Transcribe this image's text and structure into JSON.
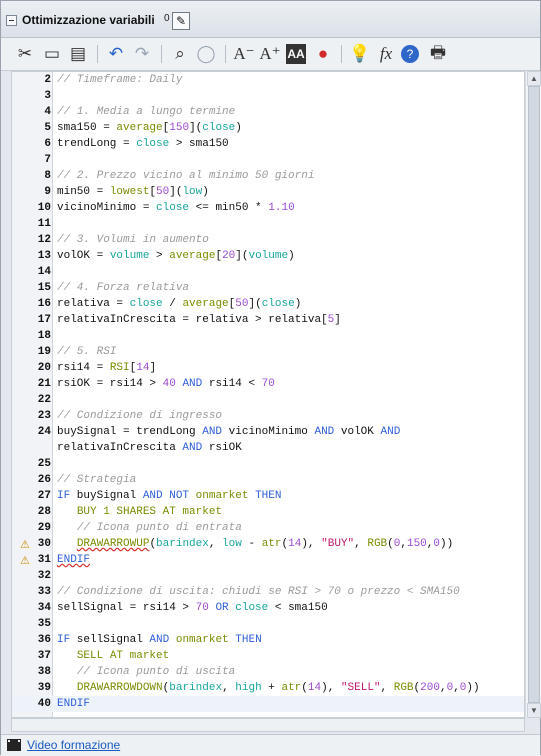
{
  "panel": {
    "title": "Ottimizzazione variabili",
    "count": "0",
    "edit_icon": "edit-icon"
  },
  "toolbar": {
    "items": [
      "cut-icon",
      "copy-icon",
      "paste-icon",
      "undo-icon",
      "redo-icon",
      "search-icon",
      "comment-icon",
      "decrease-font-icon",
      "increase-font-icon",
      "text-style-icon",
      "color-icon",
      "idea-icon",
      "function-icon",
      "help-icon",
      "print-icon"
    ]
  },
  "editor": {
    "lines": [
      {
        "n": "2",
        "html": "<span class=\"c\">// Timeframe: Daily</span>"
      },
      {
        "n": "3",
        "html": ""
      },
      {
        "n": "4",
        "html": "<span class=\"c\">// 1. Media a lungo termine</span>"
      },
      {
        "n": "5",
        "html": "sma150 = <span class=\"f\">average</span>[<span class=\"n\">150</span>](<span class=\"v\">close</span>)"
      },
      {
        "n": "6",
        "html": "trendLong = <span class=\"v\">close</span> &gt; sma150"
      },
      {
        "n": "7",
        "html": ""
      },
      {
        "n": "8",
        "html": "<span class=\"c\">// 2. Prezzo vicino al minimo 50 giorni</span>"
      },
      {
        "n": "9",
        "html": "min50 = <span class=\"f\">lowest</span>[<span class=\"n\">50</span>](<span class=\"v\">low</span>)"
      },
      {
        "n": "10",
        "html": "vicinoMinimo = <span class=\"v\">close</span> &lt;= min50 * <span class=\"n\">1.10</span>"
      },
      {
        "n": "11",
        "html": ""
      },
      {
        "n": "12",
        "html": "<span class=\"c\">// 3. Volumi in aumento</span>"
      },
      {
        "n": "13",
        "html": "volOK = <span class=\"v\">volume</span> &gt; <span class=\"f\">average</span>[<span class=\"n\">20</span>](<span class=\"v\">volume</span>)"
      },
      {
        "n": "14",
        "html": ""
      },
      {
        "n": "15",
        "html": "<span class=\"c\">// 4. Forza relativa</span>"
      },
      {
        "n": "16",
        "html": "relativa = <span class=\"v\">close</span> / <span class=\"f\">average</span>[<span class=\"n\">50</span>](<span class=\"v\">close</span>)"
      },
      {
        "n": "17",
        "html": "relativaInCrescita = relativa &gt; relativa[<span class=\"n\">5</span>]"
      },
      {
        "n": "18",
        "html": ""
      },
      {
        "n": "19",
        "html": "<span class=\"c\">// 5. RSI</span>"
      },
      {
        "n": "20",
        "html": "rsi14 = <span class=\"f\">RSI</span>[<span class=\"n\">14</span>]"
      },
      {
        "n": "21",
        "html": "rsiOK = rsi14 &gt; <span class=\"n\">40</span> <span class=\"k\">AND</span> rsi14 &lt; <span class=\"n\">70</span>"
      },
      {
        "n": "22",
        "html": ""
      },
      {
        "n": "23",
        "html": "<span class=\"c\">// Condizione di ingresso</span>"
      },
      {
        "n": "24",
        "html": "buySignal = trendLong <span class=\"k\">AND</span> vicinoMinimo <span class=\"k\">AND</span> volOK <span class=\"k\">AND</span>"
      },
      {
        "n": "",
        "html": "relativaInCrescita <span class=\"k\">AND</span> rsiOK"
      },
      {
        "n": "25",
        "html": ""
      },
      {
        "n": "26",
        "html": "<span class=\"c\">// Strategia</span>"
      },
      {
        "n": "27",
        "html": "<span class=\"k\">IF</span> buySignal <span class=\"k\">AND NOT</span> <span class=\"f\">onmarket</span> <span class=\"k\">THEN</span>"
      },
      {
        "n": "28",
        "html": "   <span class=\"f\">BUY 1 SHARES AT market</span>"
      },
      {
        "n": "29",
        "html": "   <span class=\"c\">// Icona punto di entrata</span>"
      },
      {
        "n": "30",
        "html": "   <span class=\"f err\">DRAWARROWUP</span>(<span class=\"v\">barindex</span>, <span class=\"v\">low</span> - <span class=\"f\">atr</span>(<span class=\"n\">14</span>), <span class=\"s\">\"BUY\"</span>, <span class=\"f\">RGB</span>(<span class=\"n\">0</span>,<span class=\"n\">150</span>,<span class=\"n\">0</span>))",
        "warn": true
      },
      {
        "n": "31",
        "html": "<span class=\"k err\">ENDIF</span>",
        "warn": true
      },
      {
        "n": "32",
        "html": ""
      },
      {
        "n": "33",
        "html": "<span class=\"c\">// Condizione di uscita: chiudi se RSI &gt; 70 o prezzo &lt; SMA150</span>"
      },
      {
        "n": "34",
        "html": "sellSignal = rsi14 &gt; <span class=\"n\">70</span> <span class=\"k\">OR</span> <span class=\"v\">close</span> &lt; sma150"
      },
      {
        "n": "35",
        "html": ""
      },
      {
        "n": "36",
        "html": "<span class=\"k\">IF</span> sellSignal <span class=\"k\">AND</span> <span class=\"f\">onmarket</span> <span class=\"k\">THEN</span>"
      },
      {
        "n": "37",
        "html": "   <span class=\"f\">SELL AT market</span>"
      },
      {
        "n": "38",
        "html": "   <span class=\"c\">// Icona punto di uscita</span>"
      },
      {
        "n": "39",
        "html": "   <span class=\"f\">DRAWARROWDOWN</span>(<span class=\"v\">barindex</span>, <span class=\"v\">high</span> + <span class=\"f\">atr</span>(<span class=\"n\">14</span>), <span class=\"s\">\"SELL\"</span>, <span class=\"f\">RGB</span>(<span class=\"n\">200</span>,<span class=\"n\">0</span>,<span class=\"n\">0</span>))"
      },
      {
        "n": "40",
        "html": "<span class=\"k\">ENDIF</span>",
        "current": true
      }
    ]
  },
  "footer": {
    "link": "Video formazione"
  }
}
